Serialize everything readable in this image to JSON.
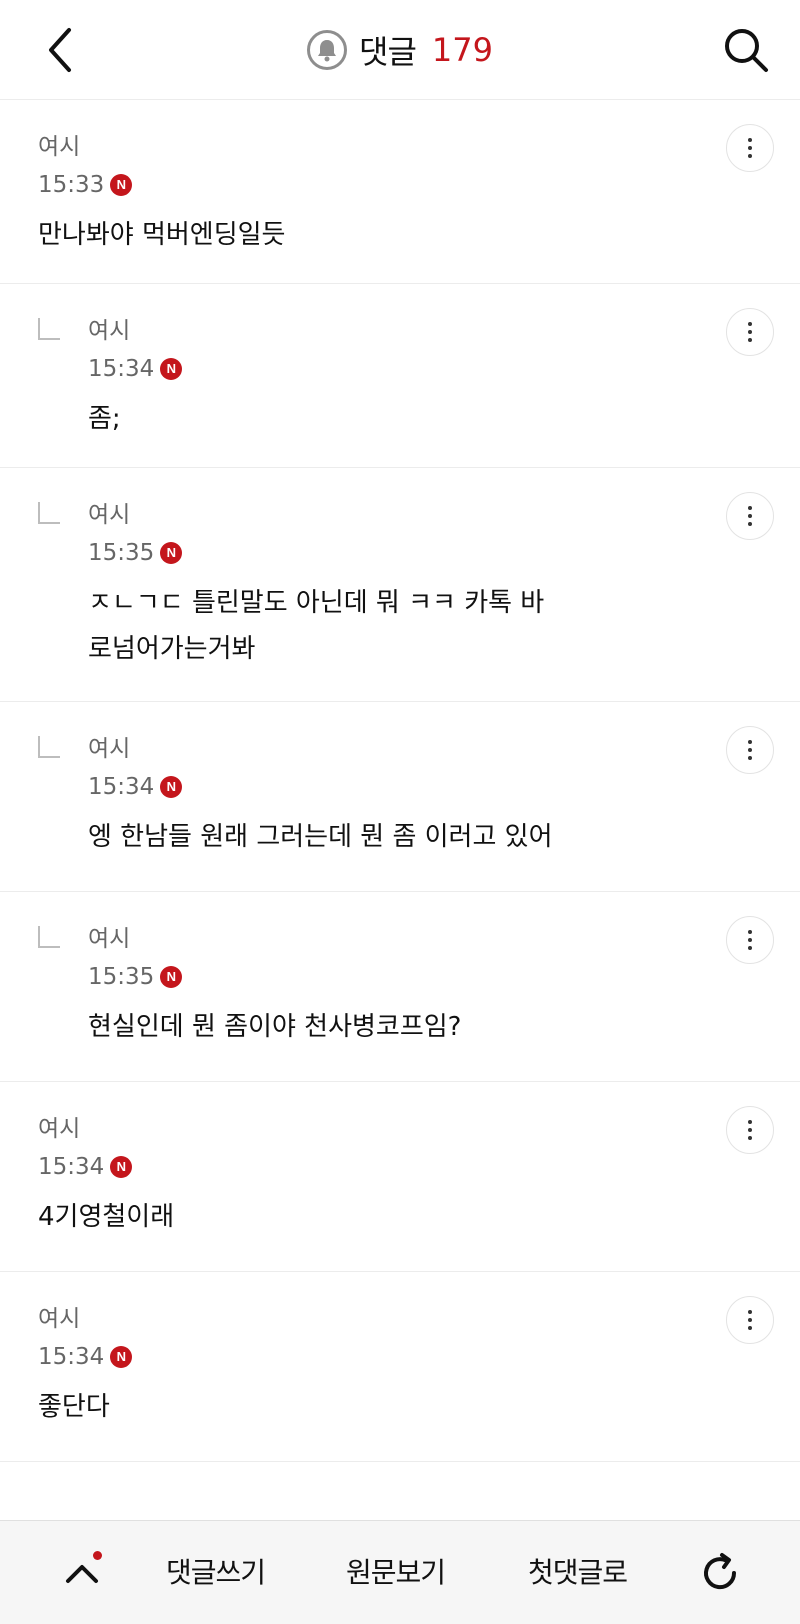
{
  "header": {
    "title": "댓글",
    "count": "179",
    "icons": {
      "back": "chevron-left-icon",
      "bell": "bell-icon",
      "search": "search-icon"
    }
  },
  "comments": [
    {
      "author": "여시",
      "time": "15:33",
      "badge": "N",
      "text": "만나봐야 먹버엔딩일듯",
      "reply": false
    },
    {
      "author": "여시",
      "time": "15:34",
      "badge": "N",
      "text": "좀;",
      "reply": true
    },
    {
      "author": "여시",
      "time": "15:35",
      "badge": "N",
      "text": "ㅈㄴㄱㄷ 틀린말도 아닌데 뭐 ㅋㅋ 카톡 바로넘어가는거봐",
      "reply": true
    },
    {
      "author": "여시",
      "time": "15:34",
      "badge": "N",
      "text": "엥 한남들 원래 그러는데 뭔 좀 이러고 있어",
      "reply": true
    },
    {
      "author": "여시",
      "time": "15:35",
      "badge": "N",
      "text": "현실인데 뭔 좀이야 천사병코프임?",
      "reply": true
    },
    {
      "author": "여시",
      "time": "15:34",
      "badge": "N",
      "text": "4기영철이래",
      "reply": false
    },
    {
      "author": "여시",
      "time": "15:34",
      "badge": "N",
      "text": "좋단다",
      "reply": false
    }
  ],
  "bottom_bar": {
    "write_label": "댓글쓰기",
    "original_label": "원문보기",
    "first_label": "첫댓글로",
    "icons": {
      "up": "chevron-up-icon",
      "refresh": "refresh-icon"
    }
  },
  "colors": {
    "accent": "#c4161c",
    "muted_text": "#666666",
    "divider": "#ececec"
  }
}
